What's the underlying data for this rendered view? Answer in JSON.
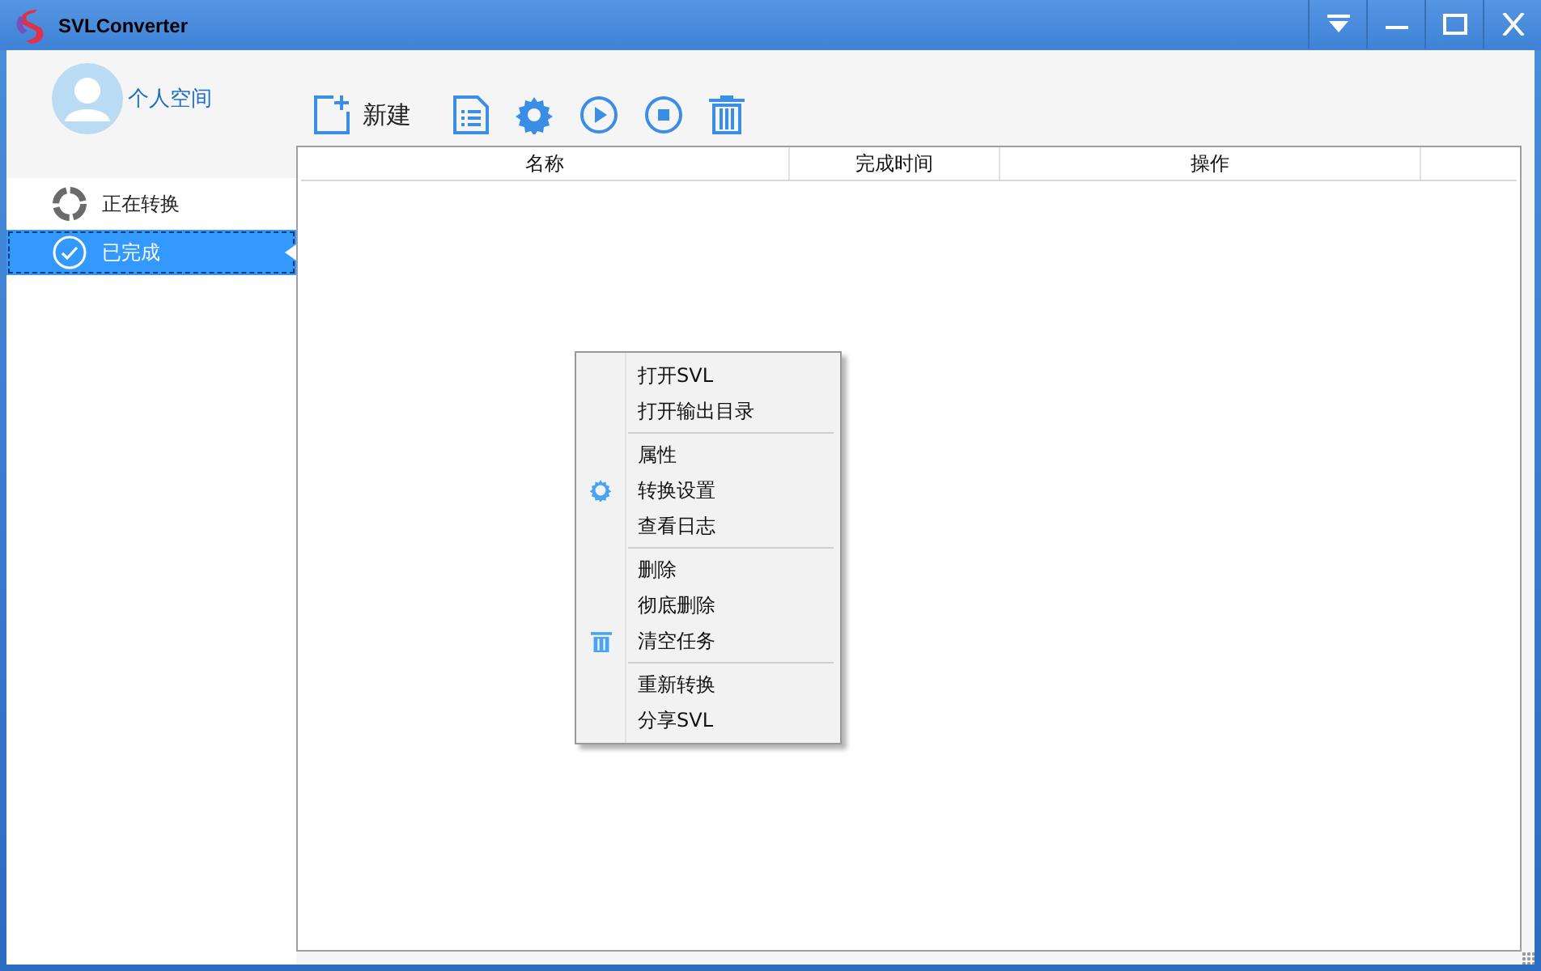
{
  "window": {
    "title": "SVLConverter"
  },
  "sidebar": {
    "user": "个人空间",
    "items": [
      {
        "label": "正在转换",
        "kind": "spinner",
        "selected": false
      },
      {
        "label": "已完成",
        "kind": "check",
        "selected": true
      }
    ]
  },
  "toolbar": [
    {
      "kind": "new",
      "label": "新建"
    },
    {
      "kind": "list"
    },
    {
      "kind": "settings"
    },
    {
      "kind": "play"
    },
    {
      "kind": "stop"
    },
    {
      "kind": "delete"
    }
  ],
  "table": {
    "columns": [
      "名称",
      "完成时间",
      "操作"
    ]
  },
  "context_menu": {
    "groups": [
      [
        {
          "label": "打开SVL"
        },
        {
          "label": "打开输出目录"
        }
      ],
      [
        {
          "label": "属性"
        },
        {
          "label": "转换设置",
          "kind": "gear"
        },
        {
          "label": "查看日志"
        }
      ],
      [
        {
          "label": "删除"
        },
        {
          "label": "彻底删除"
        },
        {
          "label": "清空任务",
          "kind": "trash"
        }
      ],
      [
        {
          "label": "重新转换"
        },
        {
          "label": "分享SVL"
        }
      ]
    ]
  }
}
